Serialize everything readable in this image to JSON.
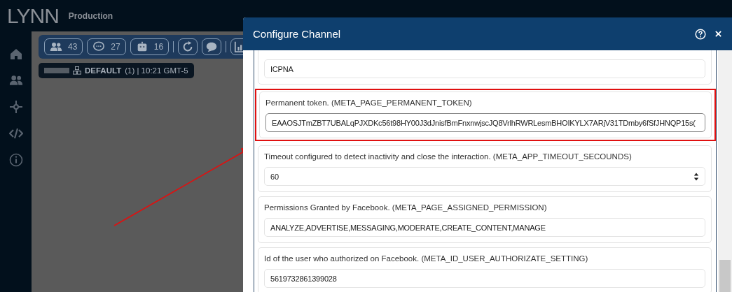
{
  "app": {
    "logo": "LYNN",
    "environment": "Production"
  },
  "sidebar": {
    "items": [
      {
        "kind": "home"
      },
      {
        "kind": "users"
      },
      {
        "kind": "network"
      },
      {
        "kind": "code"
      },
      {
        "kind": "info"
      }
    ]
  },
  "toolbar": {
    "counters": [
      {
        "kind": "users",
        "count": "43"
      },
      {
        "kind": "chat",
        "count": "27"
      },
      {
        "kind": "robot",
        "count": "16"
      }
    ],
    "actions": [
      {
        "kind": "refresh"
      },
      {
        "kind": "bubble"
      },
      {
        "kind": "chart"
      }
    ]
  },
  "status_chip": {
    "name": "DEFAULT",
    "detail": "(1) | 10:21 GMT-5"
  },
  "dialog": {
    "title": "Configure Channel",
    "fields": [
      {
        "kind": "text",
        "value": "ICPNA",
        "focused": false,
        "highlighted": false
      },
      {
        "kind": "text",
        "label": "Permanent token. (META_PAGE_PERMANENT_TOKEN)",
        "value": "EAAOSJTmZBT7UBALqPJXDKc56t98HY00J3dJnisfBmFnxnwjscJQ8VrlhRWRLesmBHOIKYLX7ARjV31TDmby6fSfJHNQP15s(",
        "focused": true,
        "highlighted": true
      },
      {
        "kind": "number",
        "label": "Timeout configured to detect inactivity and close the interaction. (META_APP_TIMEOUT_SECOUNDS)",
        "value": "60",
        "focused": false,
        "highlighted": false
      },
      {
        "kind": "text",
        "label": "Permissions Granted by Facebook. (META_PAGE_ASSIGNED_PERMISSION)",
        "value": "ANALYZE,ADVERTISE,MESSAGING,MODERATE,CREATE_CONTENT,MANAGE",
        "focused": false,
        "highlighted": false
      },
      {
        "kind": "text",
        "label": "Id of the user who authorized on Facebook. (META_ID_USER_AUTHORIZATE_SETTING)",
        "value": "5619732861399028",
        "focused": false,
        "highlighted": false
      }
    ]
  }
}
